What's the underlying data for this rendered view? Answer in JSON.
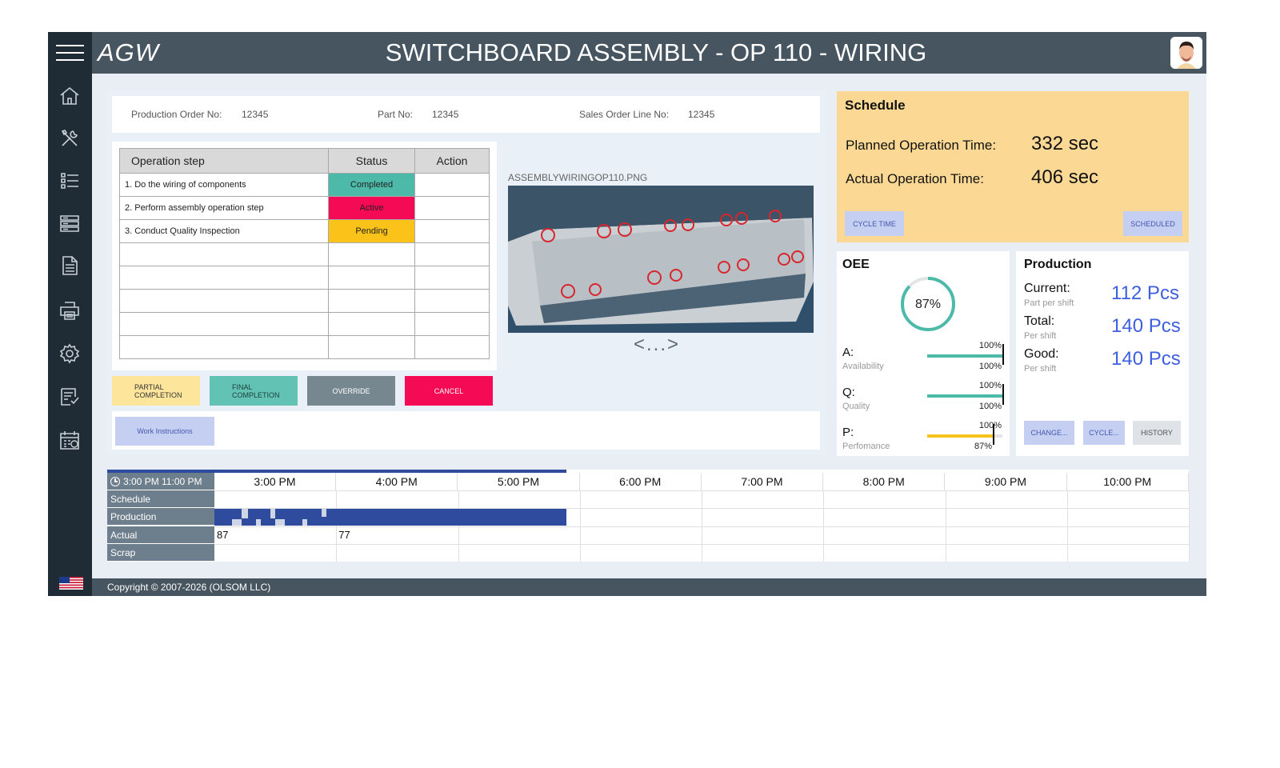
{
  "header": {
    "logo": "AGW",
    "title": "SWITCHBOARD ASSEMBLY - OP 110 - WIRING"
  },
  "sidebar": {
    "items": [
      {
        "icon": "home-icon"
      },
      {
        "icon": "tools-icon"
      },
      {
        "icon": "checklist-icon"
      },
      {
        "icon": "server-icon"
      },
      {
        "icon": "document-icon"
      },
      {
        "icon": "printer-icon"
      },
      {
        "icon": "gear-icon"
      },
      {
        "icon": "report-icon"
      },
      {
        "icon": "calendar-clock-icon"
      }
    ],
    "flag_icon": "us-flag-icon"
  },
  "order_info": {
    "production_order_label": "Production Order No:",
    "production_order_value": "12345",
    "part_no_label": "Part No:",
    "part_no_value": "12345",
    "sales_order_label": "Sales Order Line No:",
    "sales_order_value": "12345"
  },
  "operations": {
    "headers": [
      "Operation step",
      "Status",
      "Action"
    ],
    "rows": [
      {
        "step": "1. Do the wiring of components",
        "status": "Completed",
        "action": "",
        "color": "#4cb9a9"
      },
      {
        "step": "2. Perform assembly operation step",
        "status": "Active",
        "action": "",
        "color": "#f50a56"
      },
      {
        "step": "3. Conduct Quality Inspection",
        "status": "Pending",
        "action": "",
        "color": "#fbc21a"
      },
      {
        "step": "",
        "status": "",
        "action": ""
      },
      {
        "step": "",
        "status": "",
        "action": ""
      },
      {
        "step": "",
        "status": "",
        "action": ""
      },
      {
        "step": "",
        "status": "",
        "action": ""
      },
      {
        "step": "",
        "status": "",
        "action": ""
      }
    ]
  },
  "actions": {
    "partial_line1": "PARTIAL",
    "partial_line2": "COMPLETION",
    "final_line1": "FINAL",
    "final_line2": "COMPLETION",
    "override": "OVERRIDE",
    "cancel": "CANCEL",
    "work_instructions": "Work Instructions"
  },
  "image": {
    "caption": "ASSEMBLYWIRINGOP110.PNG",
    "pager": "<...>"
  },
  "schedule": {
    "title": "Schedule",
    "planned_label": "Planned Operation Time:",
    "planned_value": "332 sec",
    "actual_label": "Actual Operation Time:",
    "actual_value": "406 sec",
    "cycle_time_btn": "CYCLE TIME",
    "scheduled_btn": "SCHEDULED"
  },
  "oee": {
    "title": "OEE",
    "value": "87%",
    "value_fraction": 0.87,
    "metrics": [
      {
        "name": "A:",
        "sub": "Availability",
        "top": "100%",
        "bottom": "100%",
        "fraction": 1.0,
        "color": "#4cb9a9"
      },
      {
        "name": "Q:",
        "sub": "Quality",
        "top": "100%",
        "bottom": "100%",
        "fraction": 1.0,
        "color": "#4cb9a9"
      },
      {
        "name": "P:",
        "sub": "Perfomance",
        "top": "100%",
        "bottom": "87%",
        "fraction": 0.87,
        "color": "#f7c21e"
      }
    ]
  },
  "production": {
    "title": "Production",
    "current_label": "Current:",
    "current_sub": "Part per shift",
    "current_value": "112 Pcs",
    "total_label": "Total:",
    "total_sub": "Per shift",
    "total_value": "140 Pcs",
    "good_label": "Good:",
    "good_sub": "Per shift",
    "good_value": "140 Pcs",
    "change_btn": "CHANGE...",
    "cycle_btn": "CYCLE...",
    "history_btn": "HISTORY"
  },
  "timeline": {
    "shift": "3:00 PM 11:00 PM",
    "hours": [
      "3:00 PM",
      "4:00 PM",
      "5:00 PM",
      "6:00 PM",
      "7:00 PM",
      "8:00 PM",
      "9:00 PM",
      "10:00 PM"
    ],
    "rows": [
      "Schedule",
      "Production",
      "Actual",
      "Scrap"
    ],
    "actuals": [
      "87",
      "77"
    ]
  },
  "footer": {
    "copyright": "Copyright © 2007-2026 (OLSOM LLC)"
  },
  "colors": {
    "header_bg": "#46555f",
    "sidebar_bg": "#1f2b35",
    "accent_blue": "#3e5ee0",
    "teal": "#4cb9a9"
  }
}
